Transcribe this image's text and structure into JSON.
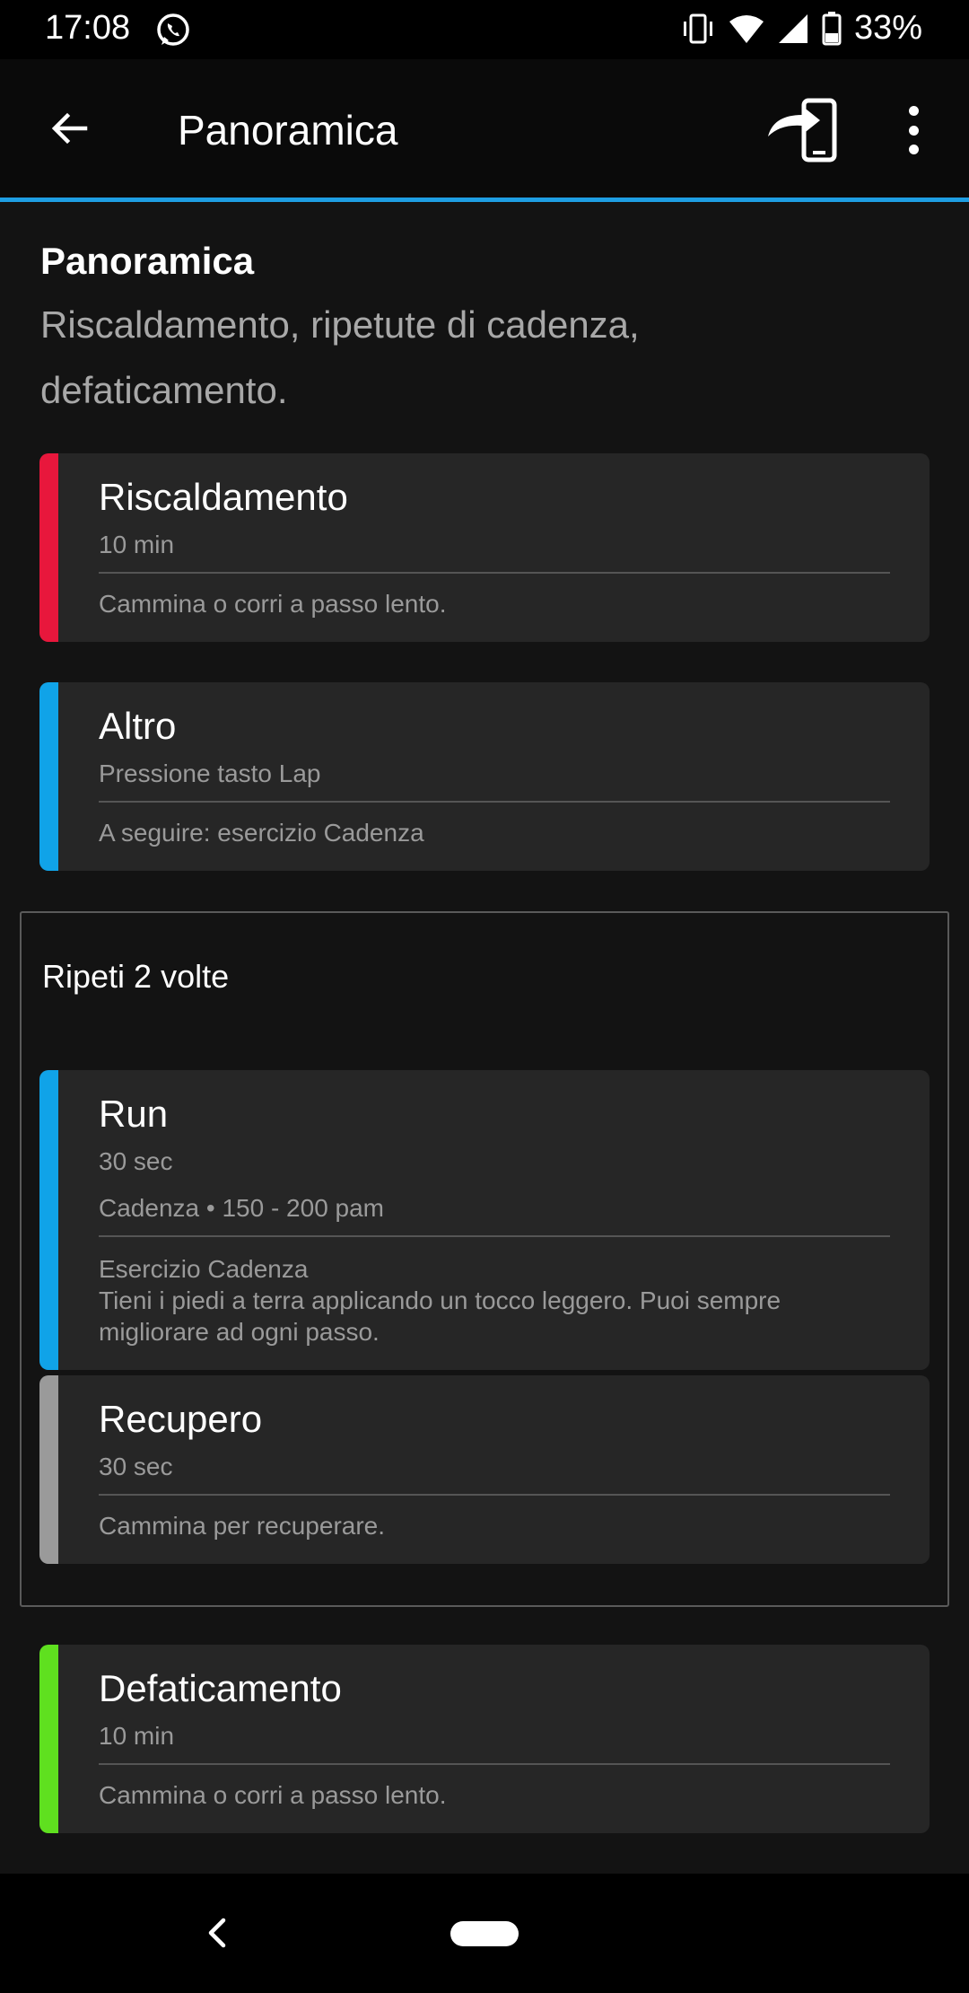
{
  "status_bar": {
    "time": "17:08",
    "battery": "33%",
    "icons": [
      "whatsapp-icon",
      "vibrate-icon",
      "wifi-icon",
      "signal-icon",
      "battery-icon"
    ]
  },
  "app_bar": {
    "title": "Panoramica",
    "icons": [
      "back-arrow-icon",
      "send-to-device-icon",
      "more-vert-icon"
    ]
  },
  "overview": {
    "title": "Panoramica",
    "description": "Riscaldamento, ripetute di cadenza, defaticamento."
  },
  "steps": [
    {
      "title": "Riscaldamento",
      "duration": "10 min",
      "note": "Cammina o corri a passo lento.",
      "color": "#e8173c"
    },
    {
      "title": "Altro",
      "duration": "Pressione tasto Lap",
      "note": "A seguire: esercizio Cadenza",
      "color": "#10a3e8"
    }
  ],
  "repeat": {
    "label": "Ripeti 2 volte",
    "steps": [
      {
        "title": "Run",
        "duration": "30 sec",
        "target": "Cadenza • 150 - 200 pam",
        "note_title": "Esercizio Cadenza",
        "note": "Tieni i piedi a terra applicando un tocco leggero. Puoi sempre migliorare ad ogni passo.",
        "color": "#10a3e8"
      },
      {
        "title": "Recupero",
        "duration": "30 sec",
        "note": "Cammina per recuperare.",
        "color": "#9a9a9a"
      }
    ]
  },
  "cooldown": {
    "title": "Defaticamento",
    "duration": "10 min",
    "note": "Cammina o corri a passo lento.",
    "color": "#5fe01f"
  },
  "nav_bar": {
    "icons": [
      "nav-back-icon",
      "nav-home-pill"
    ]
  }
}
